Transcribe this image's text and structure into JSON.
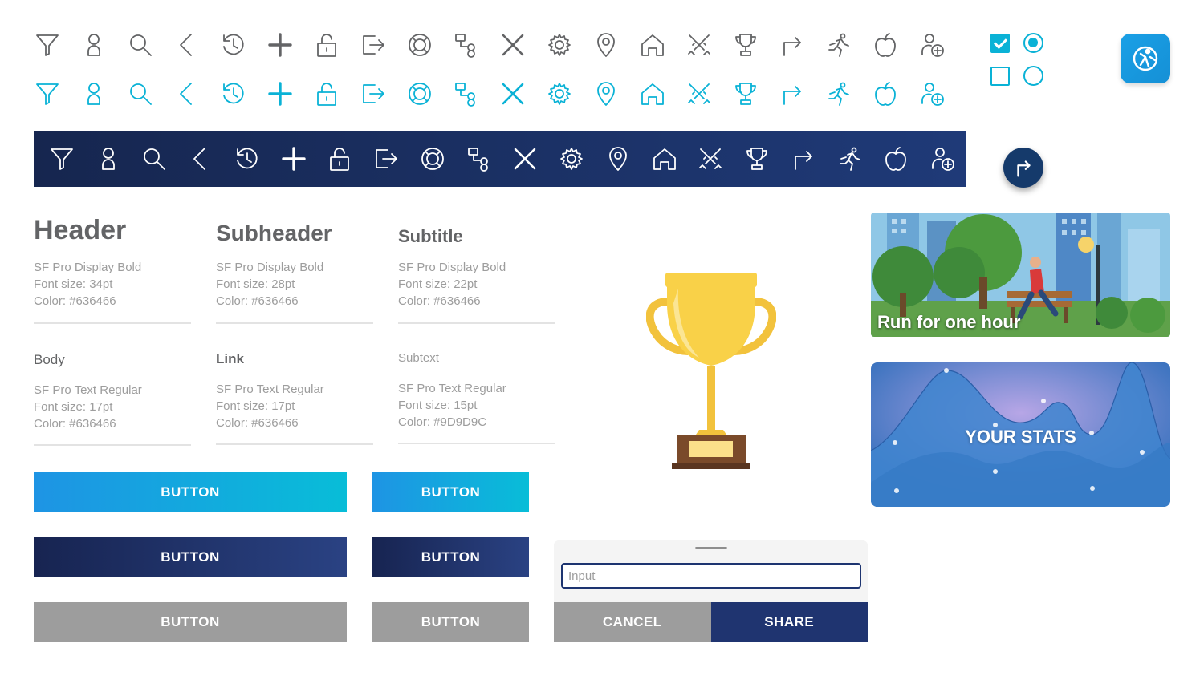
{
  "icons": [
    "filter-icon",
    "user-icon",
    "search-icon",
    "back-icon",
    "history-icon",
    "plus-icon",
    "unlock-icon",
    "logout-icon",
    "lifebuoy-icon",
    "hierarchy-icon",
    "close-icon",
    "gear-icon",
    "location-pin-icon",
    "home-icon",
    "swords-icon",
    "trophy-icon",
    "turn-right-icon",
    "runner-icon",
    "apple-icon",
    "add-user-icon"
  ],
  "colors": {
    "gray_icon": "#636466",
    "teal": "#0ab2d6",
    "navy": "#1f3470",
    "gray_button": "#9d9d9d"
  },
  "controls": {
    "checkbox_checked": true,
    "checkbox_unchecked": false,
    "radio_checked": true,
    "radio_unchecked": false
  },
  "typography": [
    {
      "title": "Header",
      "font": "SF Pro Display Bold",
      "size": "Font size: 34pt",
      "color": "Color: #636466"
    },
    {
      "title": "Subheader",
      "font": "SF Pro Display Bold",
      "size": "Font size: 28pt",
      "color": "Color: #636466"
    },
    {
      "title": "Subtitle",
      "font": "SF Pro Display Bold",
      "size": "Font size: 22pt",
      "color": "Color: #636466"
    },
    {
      "title": "Body",
      "font": "SF Pro Text Regular",
      "size": "Font size: 17pt",
      "color": "Color: #636466"
    },
    {
      "title": "Link",
      "font": "SF Pro Text Regular",
      "size": "Font size: 17pt",
      "color": "Color: #636466"
    },
    {
      "title": "Subtext",
      "font": "SF Pro Text Regular",
      "size": "Font size: 15pt",
      "color": "Color: #9D9D9C"
    }
  ],
  "buttons": {
    "label": "BUTTON"
  },
  "dialog": {
    "input_placeholder": "Input",
    "cancel": "CANCEL",
    "share": "SHARE"
  },
  "cards": {
    "run": "Run for one hour",
    "stats": "YOUR STATS"
  }
}
